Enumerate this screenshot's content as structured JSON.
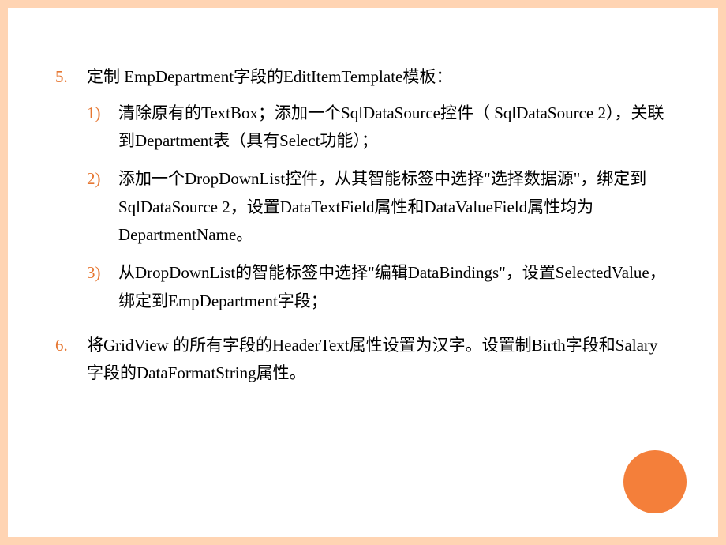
{
  "slide": {
    "items": [
      {
        "text": "定制 EmpDepartment字段的EditItemTemplate模板：",
        "subitems": [
          "清除原有的TextBox；添加一个SqlDataSource控件（ SqlDataSource 2），关联到Department表（具有Select功能）；",
          "添加一个DropDownList控件，从其智能标签中选择\"选择数据源\"，绑定到SqlDataSource 2，设置DataTextField属性和DataValueField属性均为DepartmentName。",
          "从DropDownList的智能标签中选择\"编辑DataBindings\"，设置SelectedValue，绑定到EmpDepartment字段；"
        ]
      },
      {
        "text": "将GridView 的所有字段的HeaderText属性设置为汉字。设置制Birth字段和Salary字段的DataFormatString属性。",
        "subitems": []
      }
    ]
  }
}
